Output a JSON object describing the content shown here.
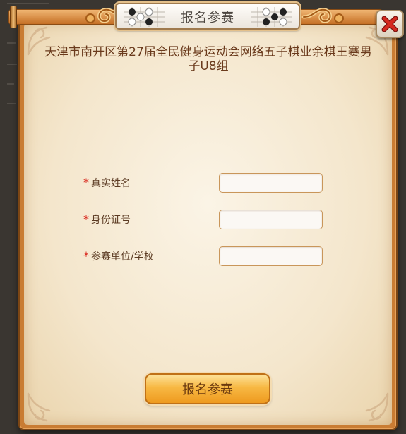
{
  "dialog": {
    "title": "报名参赛",
    "event_name": "天津市南开区第27届全民健身运动会网络五子棋业余棋王赛男子U8组",
    "required_mark": "*",
    "fields": [
      {
        "label": "真实姓名",
        "value": "",
        "placeholder": ""
      },
      {
        "label": "身份证号",
        "value": "",
        "placeholder": ""
      },
      {
        "label": "参赛单位/学校",
        "value": "",
        "placeholder": ""
      }
    ],
    "submit_label": "报名参赛"
  },
  "icons": {
    "close": "close-icon",
    "go_stones_left": "go-stones-icon",
    "go_stones_right": "go-stones-icon"
  },
  "colors": {
    "frame": "#c97c33",
    "paper": "#f4e6cc",
    "title_text": "#6a3a1c",
    "required": "#d9261c",
    "close_x": "#c8201c",
    "button": "#f7b843"
  }
}
